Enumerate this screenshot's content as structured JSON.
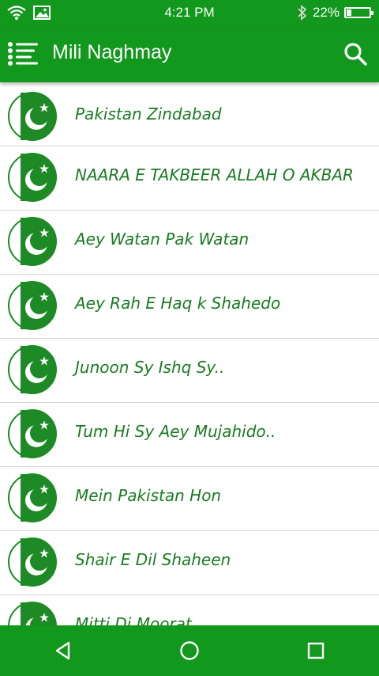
{
  "status_bar": {
    "time": "4:21 PM",
    "battery_text": "22%",
    "battery_level": 0.22,
    "icons": [
      "wifi-icon",
      "image-icon",
      "bluetooth-icon",
      "battery-icon"
    ]
  },
  "app_bar": {
    "title": "Mili Naghmay",
    "menu_icon": "menu-list-icon",
    "search_icon": "search-icon",
    "background": "#12981c"
  },
  "songs": [
    "Pakistan Zindabad",
    "NAARA E TAKBEER ALLAH O AKBAR",
    "Aey Watan Pak Watan",
    "Aey Rah E Haq k Shahedo",
    "Junoon Sy Ishq Sy..",
    "Tum Hi Sy Aey Mujahido..",
    "Mein Pakistan Hon",
    "Shair E Dil Shaheen",
    "Mitti Di Moorat"
  ],
  "colors": {
    "primary": "#12981c",
    "text": "#1a7a23"
  },
  "nav_bar": {
    "icons": [
      "back-icon",
      "home-icon",
      "recents-icon"
    ]
  }
}
